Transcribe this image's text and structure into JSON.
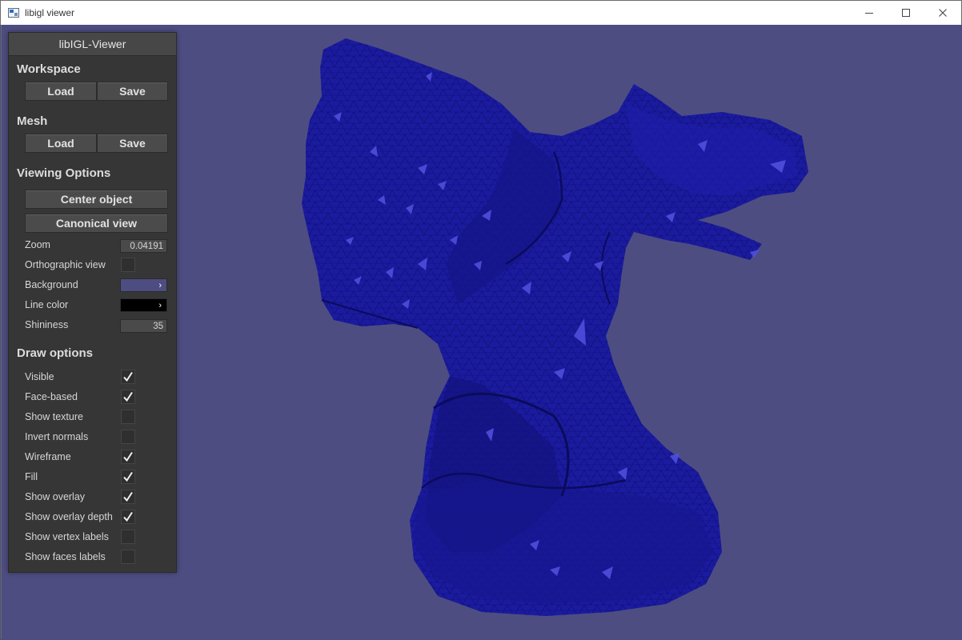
{
  "window": {
    "title": "libigl viewer",
    "icon": "app-window-icon",
    "controls": [
      "minimize-icon",
      "maximize-icon",
      "close-icon"
    ]
  },
  "viewport": {
    "background_color": "#4d4d81",
    "mesh_color": "#1a1a9e",
    "mesh_description_icon": "gargoyle-mesh"
  },
  "panel": {
    "title": "libIGL-Viewer",
    "workspace": {
      "heading": "Workspace",
      "load_label": "Load",
      "save_label": "Save"
    },
    "mesh": {
      "heading": "Mesh",
      "load_label": "Load",
      "save_label": "Save"
    },
    "viewing_options": {
      "heading": "Viewing Options",
      "center_object_label": "Center object",
      "canonical_view_label": "Canonical view",
      "zoom_label": "Zoom",
      "zoom_value": "0.04191",
      "orthographic_label": "Orthographic view",
      "orthographic_checked": false,
      "background_label": "Background",
      "background_color": "#4d4d81",
      "line_color_label": "Line color",
      "line_color": "#000000",
      "shininess_label": "Shininess",
      "shininess_value": "35",
      "swatch_arrow": "›"
    },
    "draw_options": {
      "heading": "Draw options",
      "items": [
        {
          "label": "Visible",
          "checked": true
        },
        {
          "label": "Face-based",
          "checked": true
        },
        {
          "label": "Show texture",
          "checked": false
        },
        {
          "label": "Invert normals",
          "checked": false
        },
        {
          "label": "Wireframe",
          "checked": true
        },
        {
          "label": "Fill",
          "checked": true
        },
        {
          "label": "Show overlay",
          "checked": true
        },
        {
          "label": "Show overlay depth",
          "checked": true
        },
        {
          "label": "Show vertex labels",
          "checked": false
        },
        {
          "label": "Show faces labels",
          "checked": false
        }
      ]
    }
  }
}
